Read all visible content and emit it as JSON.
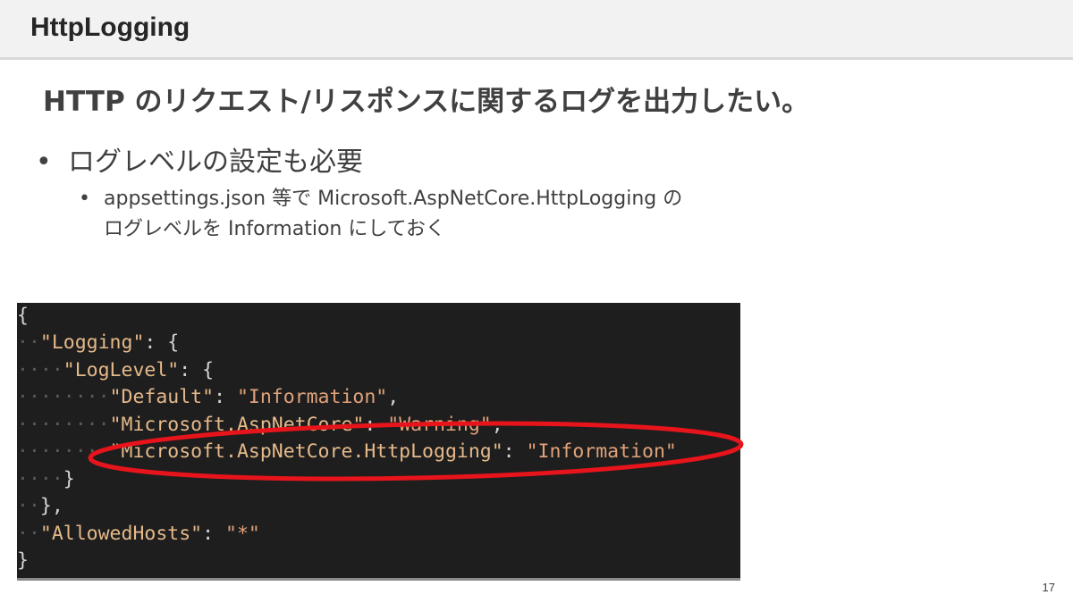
{
  "slide": {
    "title": "HttpLogging",
    "subtitle": "HTTP のリクエスト/リスポンスに関するログを出力したい。",
    "bullet1": "ログレベルの設定も必要",
    "bullet2_line1": "appsettings.json 等で Microsoft.AspNetCore.HttpLogging の",
    "bullet2_line2": "ログレベルを Information にしておく",
    "bullet_symbol": "•",
    "page_number": "17"
  },
  "code": {
    "l1_open": "{",
    "l2_key": "\"Logging\"",
    "l2_rest": ": {",
    "l3_key": "\"LogLevel\"",
    "l3_rest": ": {",
    "l4_key": "\"Default\"",
    "l4_sep": ": ",
    "l4_val": "\"Information\"",
    "l4_end": ",",
    "l5_key": "\"Microsoft.AspNetCore\"",
    "l5_sep": ": ",
    "l5_val": "\"Warning\"",
    "l5_end": ",",
    "l6_key": "\"Microsoft.AspNetCore.HttpLogging\"",
    "l6_sep": ": ",
    "l6_val": "\"Information\"",
    "l7_close": "}",
    "l8_close": "},",
    "l9_key": "\"AllowedHosts\"",
    "l9_sep": ": ",
    "l9_val": "\"*\"",
    "l10_close": "}"
  },
  "colors": {
    "code_background": "#1e1e1e",
    "highlight_ellipse": "#e8141b"
  }
}
